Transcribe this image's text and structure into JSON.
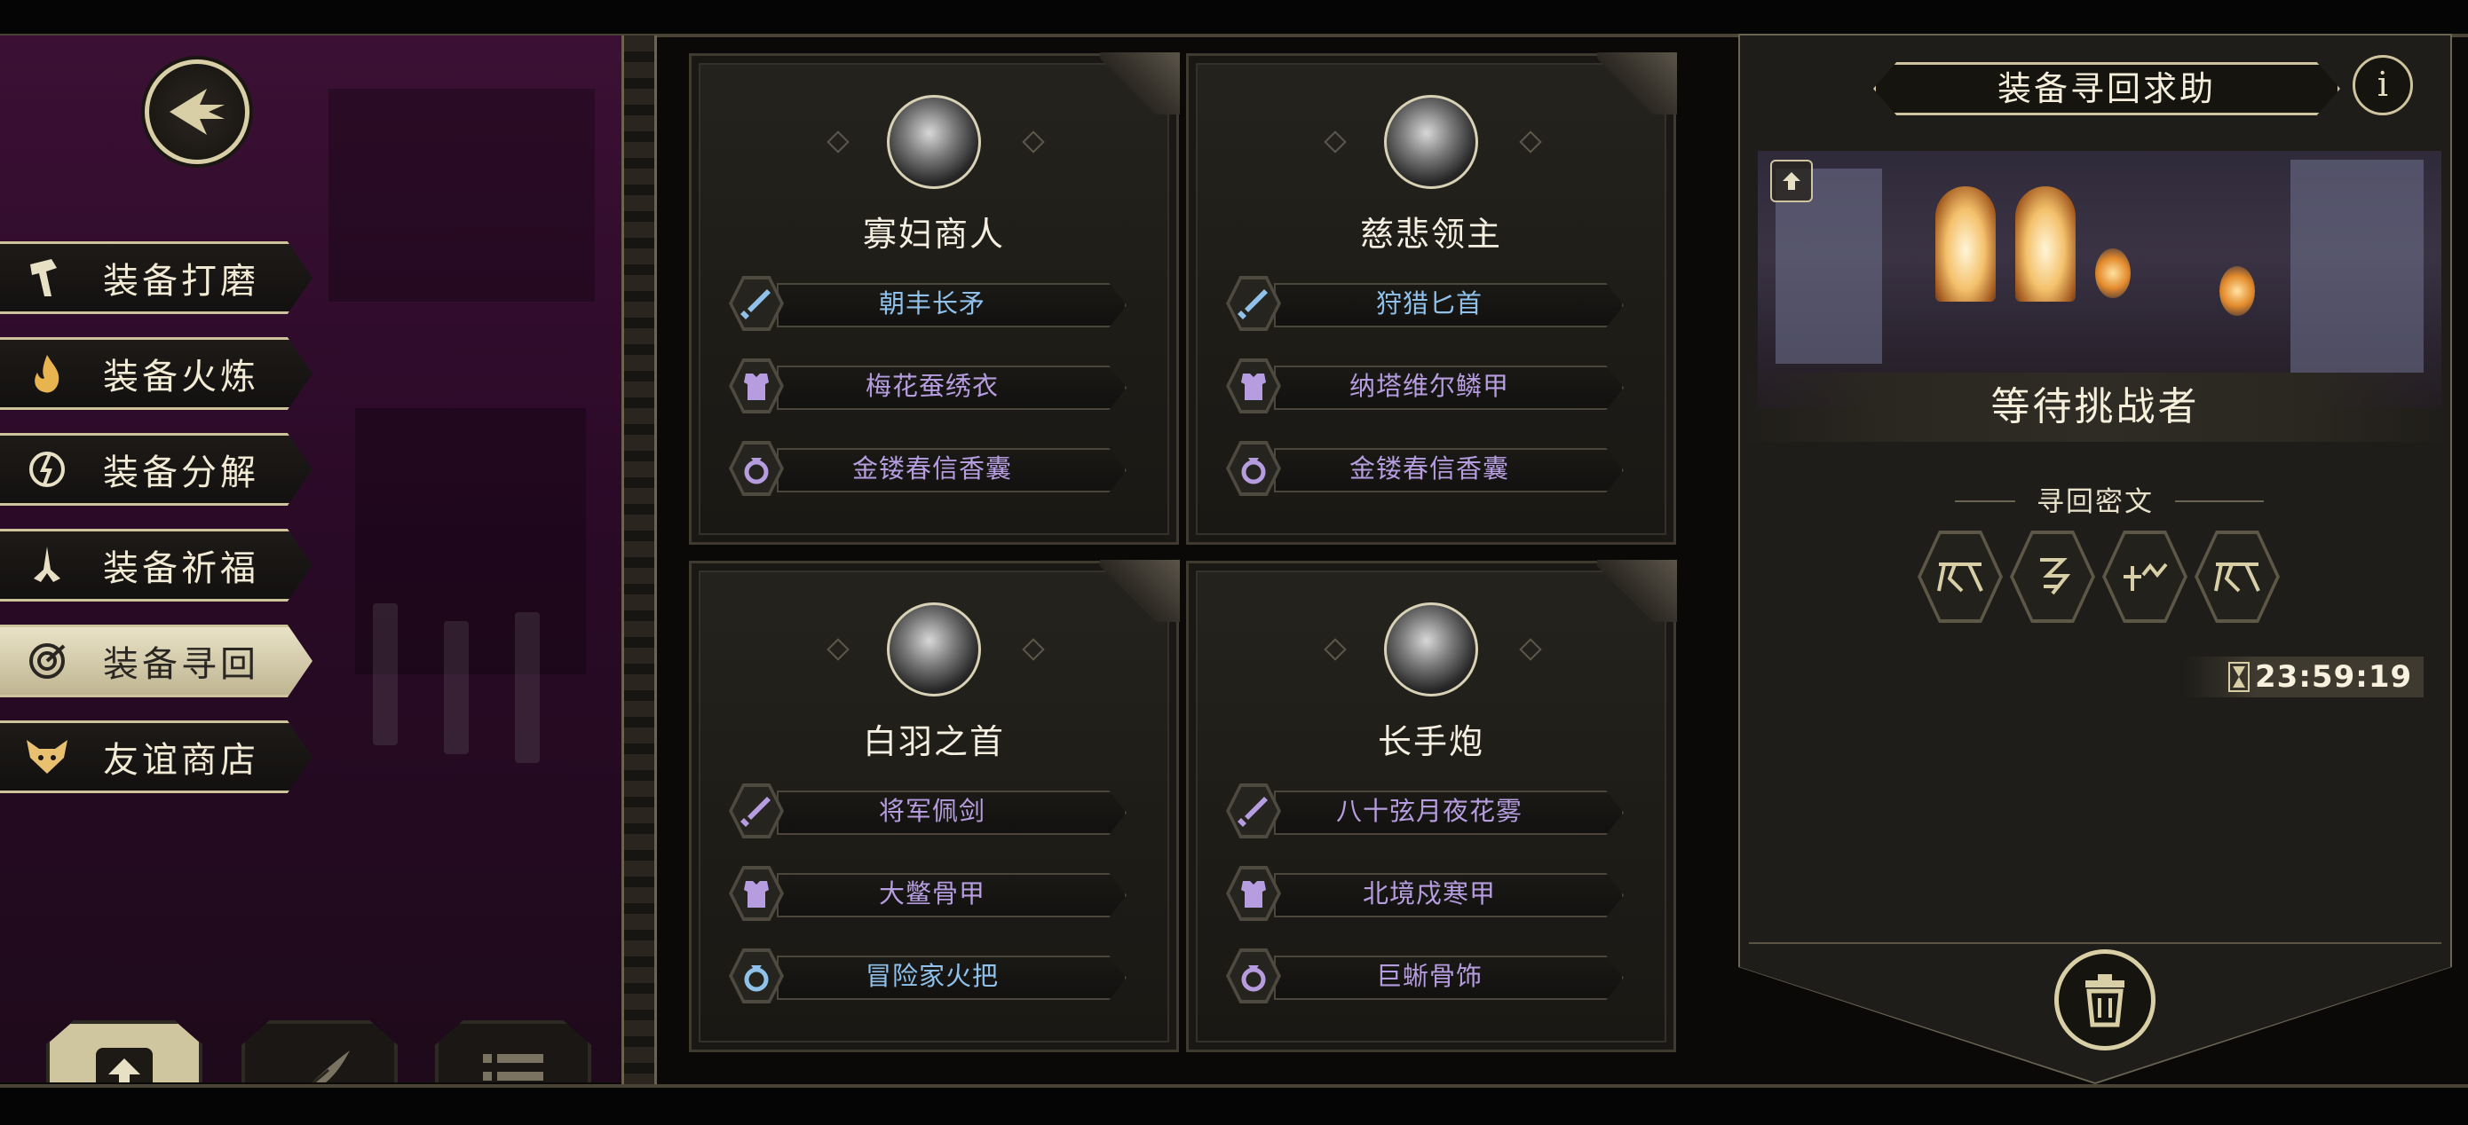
{
  "menu": {
    "items": [
      {
        "label": "装备打磨",
        "icon": "hammer-icon",
        "active": false
      },
      {
        "label": "装备火炼",
        "icon": "flame-icon",
        "active": false
      },
      {
        "label": "装备分解",
        "icon": "decompose-icon",
        "active": false
      },
      {
        "label": "装备祈福",
        "icon": "praying-hands-icon",
        "active": false
      },
      {
        "label": "装备寻回",
        "icon": "target-icon",
        "active": true
      },
      {
        "label": "友谊商店",
        "icon": "fox-icon",
        "active": false
      }
    ],
    "bottom_tabs": [
      {
        "icon": "upload-icon",
        "active": true
      },
      {
        "icon": "feather-icon",
        "active": false
      },
      {
        "icon": "list-icon",
        "active": false
      }
    ]
  },
  "cards": [
    {
      "owner": "寡妇商人",
      "items": [
        {
          "name": "朝丰长矛",
          "type": "weapon",
          "color": "#8fc1ea"
        },
        {
          "name": "梅花蚕绣衣",
          "type": "armor",
          "color": "#b69ddf"
        },
        {
          "name": "金镂春信香囊",
          "type": "accessory",
          "color": "#b69ddf"
        }
      ]
    },
    {
      "owner": "慈悲领主",
      "items": [
        {
          "name": "狩猎匕首",
          "type": "weapon",
          "color": "#8fc1ea"
        },
        {
          "name": "纳塔维尔鳞甲",
          "type": "armor",
          "color": "#b69ddf"
        },
        {
          "name": "金镂春信香囊",
          "type": "accessory",
          "color": "#b69ddf"
        }
      ]
    },
    {
      "owner": "白羽之首",
      "items": [
        {
          "name": "将军佩剑",
          "type": "weapon",
          "color": "#b69ddf"
        },
        {
          "name": "大鳖骨甲",
          "type": "armor",
          "color": "#b69ddf"
        },
        {
          "name": "冒险家火把",
          "type": "accessory",
          "color": "#8fc1ea"
        }
      ]
    },
    {
      "owner": "长手炮",
      "items": [
        {
          "name": "八十弦月夜花雾",
          "type": "weapon",
          "color": "#b69ddf"
        },
        {
          "name": "北境戍寒甲",
          "type": "armor",
          "color": "#b69ddf"
        },
        {
          "name": "巨蜥骨饰",
          "type": "accessory",
          "color": "#b69ddf"
        }
      ]
    }
  ],
  "panel": {
    "title": "装备寻回求助",
    "info_label": "i",
    "status": "等待挑战者",
    "cipher_title": "寻回密文",
    "runes": [
      "rune-1",
      "rune-2",
      "rune-3",
      "rune-4"
    ],
    "timer": "23:59:19"
  },
  "colors": {
    "accent_gold": "#d9cfa7",
    "menu_bg": "#2a0a27",
    "blue_item": "#8fc1ea",
    "purple_item": "#b69ddf"
  }
}
